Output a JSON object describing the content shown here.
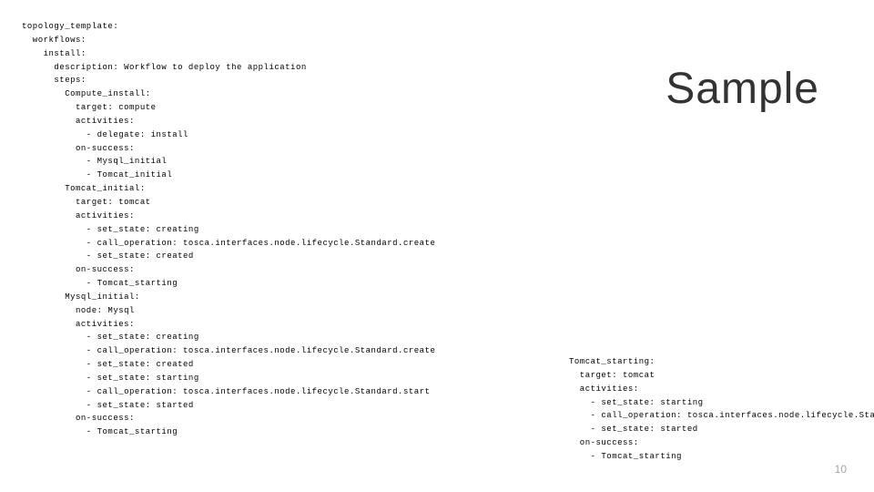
{
  "title": "Sample",
  "page_number": "10",
  "code_left": "topology_template:\n  workflows:\n    install:\n      description: Workflow to deploy the application\n      steps:\n        Compute_install:\n          target: compute\n          activities:\n            - delegate: install\n          on-success:\n            - Mysql_initial\n            - Tomcat_initial\n        Tomcat_initial:\n          target: tomcat\n          activities:\n            - set_state: creating\n            - call_operation: tosca.interfaces.node.lifecycle.Standard.create\n            - set_state: created\n          on-success:\n            - Tomcat_starting\n        Mysql_initial:\n          node: Mysql\n          activities:\n            - set_state: creating\n            - call_operation: tosca.interfaces.node.lifecycle.Standard.create\n            - set_state: created\n            - set_state: starting\n            - call_operation: tosca.interfaces.node.lifecycle.Standard.start\n            - set_state: started\n          on-success:\n            - Tomcat_starting",
  "code_right": "Tomcat_starting:\n  target: tomcat\n  activities:\n    - set_state: starting\n    - call_operation: tosca.interfaces.node.lifecycle.Standard.start\n    - set_state: started\n  on-success:\n    - Tomcat_starting"
}
